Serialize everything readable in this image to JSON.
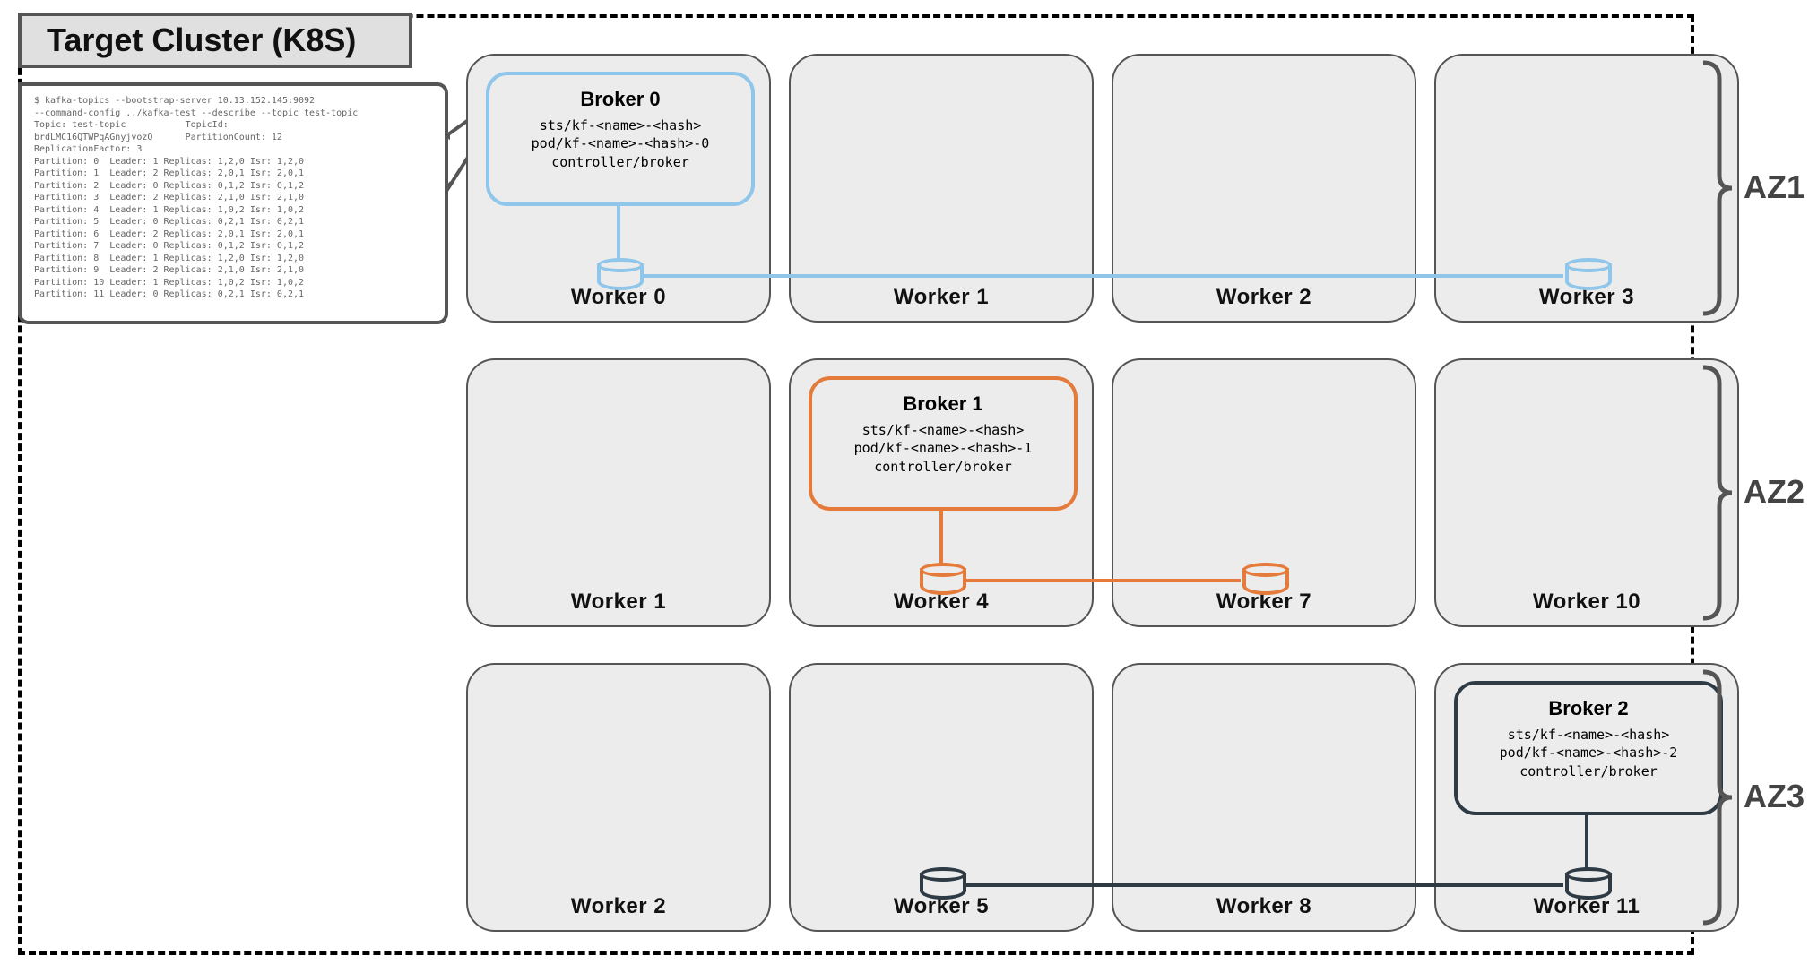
{
  "title": "Target Cluster (K8S)",
  "az_labels": [
    "AZ1",
    "AZ2",
    "AZ3"
  ],
  "colors": {
    "blue": "#8fc6ea",
    "orange": "#e57b3a",
    "dark": "#2e3b45"
  },
  "rows": [
    {
      "az": "AZ1",
      "color": "blue",
      "workers": [
        {
          "label": "Worker 0",
          "broker": {
            "title": "Broker 0",
            "lines": [
              "sts/kf-<name>-<hash>",
              "pod/kf-<name>-<hash>-0",
              "controller/broker"
            ]
          },
          "drive": true
        },
        {
          "label": "Worker 1"
        },
        {
          "label": "Worker 2"
        },
        {
          "label": "Worker 3",
          "drive": true
        }
      ],
      "link_from": 0,
      "link_to": 3
    },
    {
      "az": "AZ2",
      "color": "orange",
      "workers": [
        {
          "label": "Worker 1"
        },
        {
          "label": "Worker 4",
          "broker": {
            "title": "Broker 1",
            "lines": [
              "sts/kf-<name>-<hash>",
              "pod/kf-<name>-<hash>-1",
              "controller/broker"
            ]
          },
          "drive": true
        },
        {
          "label": "Worker 7",
          "drive": true
        },
        {
          "label": "Worker 10"
        }
      ],
      "link_from": 1,
      "link_to": 2
    },
    {
      "az": "AZ3",
      "color": "dark",
      "workers": [
        {
          "label": "Worker 2"
        },
        {
          "label": "Worker 5",
          "drive": true
        },
        {
          "label": "Worker 8"
        },
        {
          "label": "Worker 11",
          "broker": {
            "title": "Broker 2",
            "lines": [
              "sts/kf-<name>-<hash>",
              "pod/kf-<name>-<hash>-2",
              "controller/broker"
            ]
          },
          "drive": true
        }
      ],
      "link_from": 1,
      "link_to": 3
    }
  ],
  "terminal": {
    "header": [
      "$ kafka-topics --bootstrap-server 10.13.152.145:9092",
      "--command-config ../kafka-test --describe --topic test-topic",
      "Topic: test-topic           TopicId:",
      "brdLMC16QTWPqAGnyjvozQ      PartitionCount: 12",
      "ReplicationFactor: 3",
      ""
    ],
    "partitions": [
      {
        "p": 0,
        "leader": 1,
        "replicas": "1,2,0",
        "isr": "1,2,0"
      },
      {
        "p": 1,
        "leader": 2,
        "replicas": "2,0,1",
        "isr": "2,0,1"
      },
      {
        "p": 2,
        "leader": 0,
        "replicas": "0,1,2",
        "isr": "0,1,2"
      },
      {
        "p": 3,
        "leader": 2,
        "replicas": "2,1,0",
        "isr": "2,1,0"
      },
      {
        "p": 4,
        "leader": 1,
        "replicas": "1,0,2",
        "isr": "1,0,2"
      },
      {
        "p": 5,
        "leader": 0,
        "replicas": "0,2,1",
        "isr": "0,2,1"
      },
      {
        "p": 6,
        "leader": 2,
        "replicas": "2,0,1",
        "isr": "2,0,1"
      },
      {
        "p": 7,
        "leader": 0,
        "replicas": "0,1,2",
        "isr": "0,1,2"
      },
      {
        "p": 8,
        "leader": 1,
        "replicas": "1,2,0",
        "isr": "1,2,0"
      },
      {
        "p": 9,
        "leader": 2,
        "replicas": "2,1,0",
        "isr": "2,1,0"
      },
      {
        "p": 10,
        "leader": 1,
        "replicas": "1,0,2",
        "isr": "1,0,2"
      },
      {
        "p": 11,
        "leader": 0,
        "replicas": "0,2,1",
        "isr": "0,2,1"
      }
    ]
  }
}
